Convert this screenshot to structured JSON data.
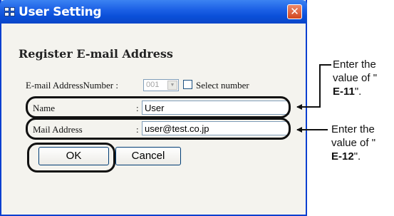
{
  "window": {
    "title": "User Setting",
    "close_glyph": "✕"
  },
  "form": {
    "heading": "Register E-mail Address",
    "address_number": {
      "label": "E-mail AddressNumber :",
      "value": "001",
      "select_label": "Select number"
    },
    "name": {
      "label": "Name",
      "colon": ":",
      "value": "User"
    },
    "mail": {
      "label": "Mail Address",
      "colon": ":",
      "value": "user@test.co.jp"
    },
    "ok_label": "OK",
    "cancel_label": "Cancel"
  },
  "annotations": [
    {
      "line1": "Enter the",
      "line2": "value of \"",
      "code": "E-11",
      "suffix": "\"."
    },
    {
      "line1": "Enter the",
      "line2": "value of \"",
      "code": "E-12",
      "suffix": "\"."
    }
  ]
}
